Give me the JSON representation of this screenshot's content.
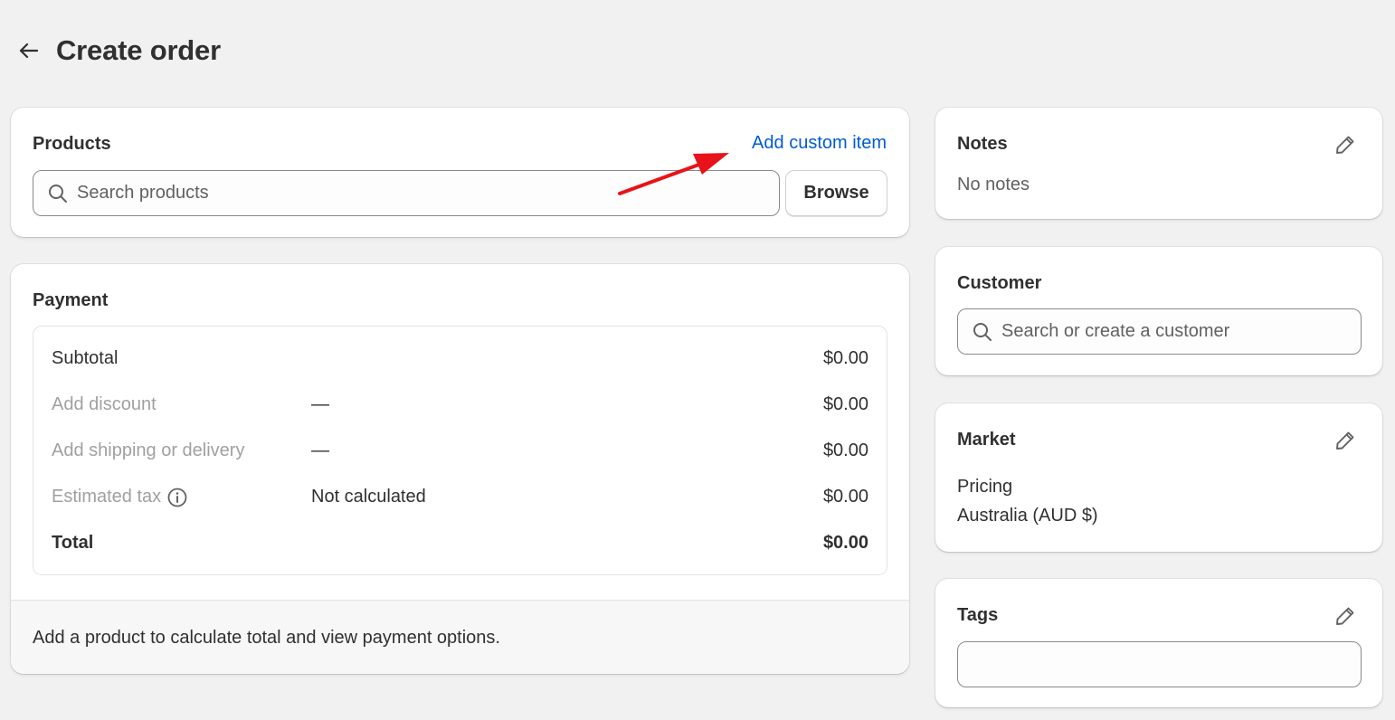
{
  "header": {
    "back_icon": "arrow-left-icon",
    "title": "Create order"
  },
  "products": {
    "title": "Products",
    "add_custom_item": "Add custom item",
    "search_placeholder": "Search products",
    "browse_label": "Browse",
    "annotation_color": "#e8131a"
  },
  "payment": {
    "title": "Payment",
    "rows": [
      {
        "label": "Subtotal",
        "detail": "",
        "amount": "$0.00"
      },
      {
        "label": "Add discount",
        "detail": "—",
        "amount": "$0.00"
      },
      {
        "label": "Add shipping or delivery",
        "detail": "—",
        "amount": "$0.00"
      },
      {
        "label": "Estimated tax",
        "detail": "Not calculated",
        "amount": "$0.00"
      },
      {
        "label": "Total",
        "detail": "",
        "amount": "$0.00"
      }
    ],
    "footer_text": "Add a product to calculate total and view payment options."
  },
  "notes": {
    "title": "Notes",
    "value": "No notes"
  },
  "customer": {
    "title": "Customer",
    "search_placeholder": "Search or create a customer"
  },
  "market": {
    "title": "Market",
    "pricing_label": "Pricing",
    "pricing_value": "Australia (AUD $)"
  },
  "tags": {
    "title": "Tags",
    "value": ""
  },
  "colors": {
    "link": "#005bd3",
    "background": "#f1f1f1",
    "text": "#303030",
    "muted": "#a0a0a0"
  }
}
